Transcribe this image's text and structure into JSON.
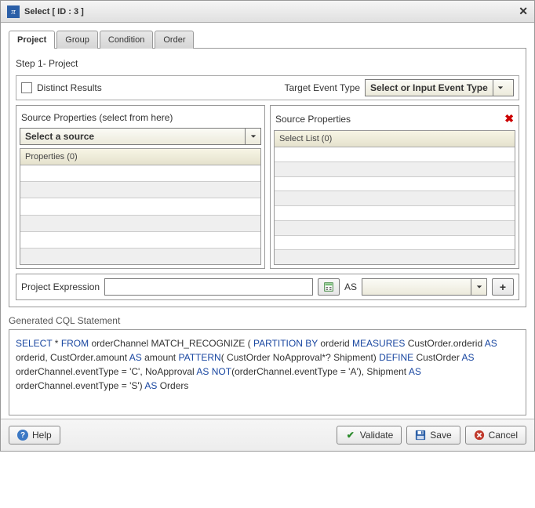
{
  "window": {
    "app_symbol": "π",
    "title": "Select [ ID : 3 ]"
  },
  "tabs": {
    "items": [
      {
        "label": "Project",
        "active": true
      },
      {
        "label": "Group",
        "active": false
      },
      {
        "label": "Condition",
        "active": false
      },
      {
        "label": "Order",
        "active": false
      }
    ]
  },
  "step": {
    "label": "Step 1- Project"
  },
  "distinct": {
    "label": "Distinct Results",
    "checked": false
  },
  "target": {
    "label": "Target Event Type",
    "selected": "Select or Input Event Type"
  },
  "left_panel": {
    "title": "Source Properties (select from here)",
    "source_select": "Select a source",
    "grid_header": "Properties (0)"
  },
  "right_panel": {
    "title": "Source Properties",
    "grid_header": "Select List (0)"
  },
  "proj_expr": {
    "label": "Project Expression",
    "value": "",
    "as_label": "AS",
    "as_value": ""
  },
  "cql": {
    "title": "Generated CQL Statement",
    "tokens": [
      {
        "t": "SELECT",
        "k": 1
      },
      {
        "t": " * "
      },
      {
        "t": "FROM",
        "k": 1
      },
      {
        "t": " orderChannel  MATCH_RECOGNIZE ( "
      },
      {
        "t": "PARTITION BY",
        "k": 1
      },
      {
        "t": " orderid "
      },
      {
        "t": "MEASURES",
        "k": 1
      },
      {
        "t": " CustOrder.orderid "
      },
      {
        "t": "AS",
        "k": 1
      },
      {
        "t": " orderid, CustOrder.amount "
      },
      {
        "t": "AS",
        "k": 1
      },
      {
        "t": " amount "
      },
      {
        "t": "PATTERN",
        "k": 1
      },
      {
        "t": "( CustOrder NoApproval*? Shipment) "
      },
      {
        "t": "DEFINE",
        "k": 1
      },
      {
        "t": " CustOrder "
      },
      {
        "t": "AS",
        "k": 1
      },
      {
        "t": " orderChannel.eventType = 'C', NoApproval "
      },
      {
        "t": "AS",
        "k": 1
      },
      {
        "t": " "
      },
      {
        "t": "NOT",
        "k": 1
      },
      {
        "t": "(orderChannel.eventType = 'A'), Shipment "
      },
      {
        "t": "AS",
        "k": 1
      },
      {
        "t": " orderChannel.eventType = 'S') "
      },
      {
        "t": "AS",
        "k": 1
      },
      {
        "t": " Orders"
      }
    ]
  },
  "footer": {
    "help": "Help",
    "validate": "Validate",
    "save": "Save",
    "cancel": "Cancel"
  }
}
